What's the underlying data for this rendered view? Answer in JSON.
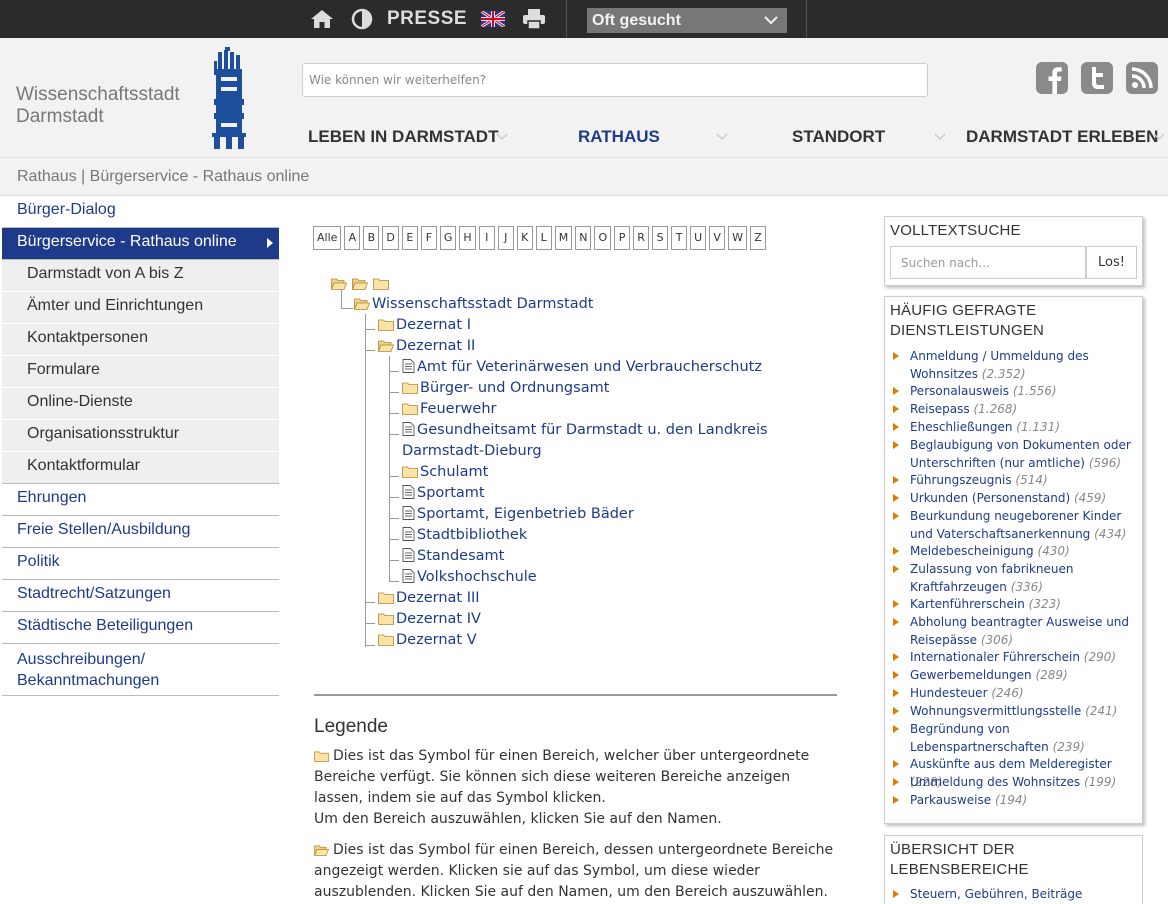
{
  "colors": {
    "topbar_bg": "#2b2b2b",
    "accent_blue": "#1d3b8a",
    "orange_arrow": "#e07b00",
    "header_bg": "#f2f2f2"
  },
  "topbar": {
    "icons": [
      "home-icon",
      "contrast-icon",
      "uk-flag-icon",
      "print-icon"
    ],
    "presse_label": "PRESSE",
    "select_value": "Oft gesucht"
  },
  "header": {
    "logo_line1": "Wissenschaftsstadt",
    "logo_line2": "Darmstadt",
    "search_placeholder": "Wie können wir weiterhelfen?",
    "social_icons": [
      "facebook-icon",
      "twitter-icon",
      "rss-icon"
    ],
    "nav": [
      "LEBEN IN DARMSTADT",
      "RATHAUS",
      "STANDORT",
      "DARMSTADT ERLEBEN"
    ],
    "active_nav": "RATHAUS"
  },
  "breadcrumb": "Rathaus | Bürgerservice - Rathaus online",
  "sidebar": {
    "items": [
      {
        "label": "Bürger-Dialog"
      },
      {
        "label": "Bürgerservice - Rathaus online",
        "active": true
      },
      {
        "label": "Darmstadt von A bis Z",
        "sub": true
      },
      {
        "label": "Ämter und Einrichtungen",
        "sub": true
      },
      {
        "label": "Kontaktpersonen",
        "sub": true
      },
      {
        "label": "Formulare",
        "sub": true
      },
      {
        "label": "Online-Dienste",
        "sub": true
      },
      {
        "label": "Organisationsstruktur",
        "sub": true
      },
      {
        "label": "Kontaktformular",
        "sub": true
      },
      {
        "label": "Ehrungen"
      },
      {
        "label": "Freie Stellen/Ausbildung"
      },
      {
        "label": "Politik"
      },
      {
        "label": "Stadtrecht/Satzungen"
      },
      {
        "label": "Städtische Beteiligungen"
      },
      {
        "label_line1": "Ausschreibungen/",
        "label_line2": "Bekanntmachungen"
      }
    ]
  },
  "alphabet": [
    "Alle",
    "A",
    "B",
    "D",
    "E",
    "F",
    "G",
    "H",
    "I",
    "J",
    "K",
    "L",
    "M",
    "N",
    "O",
    "P",
    "R",
    "S",
    "T",
    "U",
    "V",
    "W",
    "Z"
  ],
  "tree": {
    "root": "Wissenschaftsstadt Darmstadt",
    "dezernat1": "Dezernat I",
    "dezernat2": "Dezernat II",
    "children2": [
      "Amt für Veterinärwesen und Verbraucherschutz",
      "Bürger- und Ordnungsamt",
      "Feuerwehr",
      "Gesundheitsamt für Darmstadt u. den Landkreis",
      "Darmstadt-Dieburg",
      "Schulamt",
      "Sportamt",
      "Sportamt, Eigenbetrieb Bäder",
      "Stadtbibliothek",
      "Standesamt",
      "Volkshochschule"
    ],
    "dezernat3": "Dezernat III",
    "dezernat4": "Dezernat IV",
    "dezernat5": "Dezernat V"
  },
  "legend": {
    "title": "Legende",
    "p1": "Dies ist das Symbol für einen Bereich, welcher über untergeordnete Bereiche verfügt. Sie können sich diese weiteren Bereiche anzeigen lassen, indem sie auf das Symbol klicken.",
    "p1b": "Um den Bereich auszuwählen, klicken Sie auf den Namen.",
    "p2": "Dies ist das Symbol für einen Bereich, dessen untergeordnete Bereiche angezeigt werden. Klicken sie auf das Symbol, um diese wieder auszublenden. Klicken Sie auf den Namen, um den Bereich auszuwählen."
  },
  "volltextsuche": {
    "title": "VOLLTEXTSUCHE",
    "placeholder": "Suchen nach...",
    "button": "Los!"
  },
  "faq": {
    "title_line1": "HÄUFIG GEFRAGTE",
    "title_line2": "DIENSTLEISTUNGEN",
    "items": [
      {
        "l1": "Anmeldung / Ummeldung des",
        "l2": "Wohnsitzes",
        "count": "(2.352)"
      },
      {
        "l1": "Personalausweis",
        "count": "(1.556)"
      },
      {
        "l1": "Reisepass",
        "count": "(1.268)"
      },
      {
        "l1": "Eheschließungen",
        "count": "(1.131)"
      },
      {
        "l1": "Beglaubigung von Dokumenten oder",
        "l2": "Unterschriften (nur amtliche)",
        "count": "(596)"
      },
      {
        "l1": "Führungszeugnis",
        "count": "(514)"
      },
      {
        "l1": "Urkunden (Personenstand)",
        "count": "(459)"
      },
      {
        "l1": "Beurkundung neugeborener Kinder",
        "l2": "und Vaterschaftsanerkennung",
        "count": "(434)"
      },
      {
        "l1": "Meldebescheinigung",
        "count": "(430)"
      },
      {
        "l1": "Zulassung von fabrikneuen",
        "l2": "Kraftfahrzeugen",
        "count": "(336)"
      },
      {
        "l1": "Kartenführerschein",
        "count": "(323)"
      },
      {
        "l1": "Abholung beantragter Ausweise und",
        "l2": "Reisepässe",
        "count": "(306)"
      },
      {
        "l1": "Internationaler Führerschein",
        "count": "(290)"
      },
      {
        "l1": "Gewerbemeldungen",
        "count": "(289)"
      },
      {
        "l1": "Hundesteuer",
        "count": "(246)"
      },
      {
        "l1": "Wohnungsvermittlungsstelle",
        "count": "(241)"
      },
      {
        "l1": "Begründung von",
        "l2": "Lebenspartnerschaften",
        "count": "(239)"
      },
      {
        "l1": "Auskünfte aus dem Melderegister",
        "count": "(228)"
      },
      {
        "l1": "Ummeldung des Wohnsitzes",
        "count": "(199)"
      },
      {
        "l1": "Parkausweise",
        "count": "(194)"
      }
    ]
  },
  "lebensbereiche": {
    "title_line1": "ÜBERSICHT DER",
    "title_line2": "LEBENSBEREICHE",
    "first_item": "Steuern, Gebühren, Beiträge"
  }
}
